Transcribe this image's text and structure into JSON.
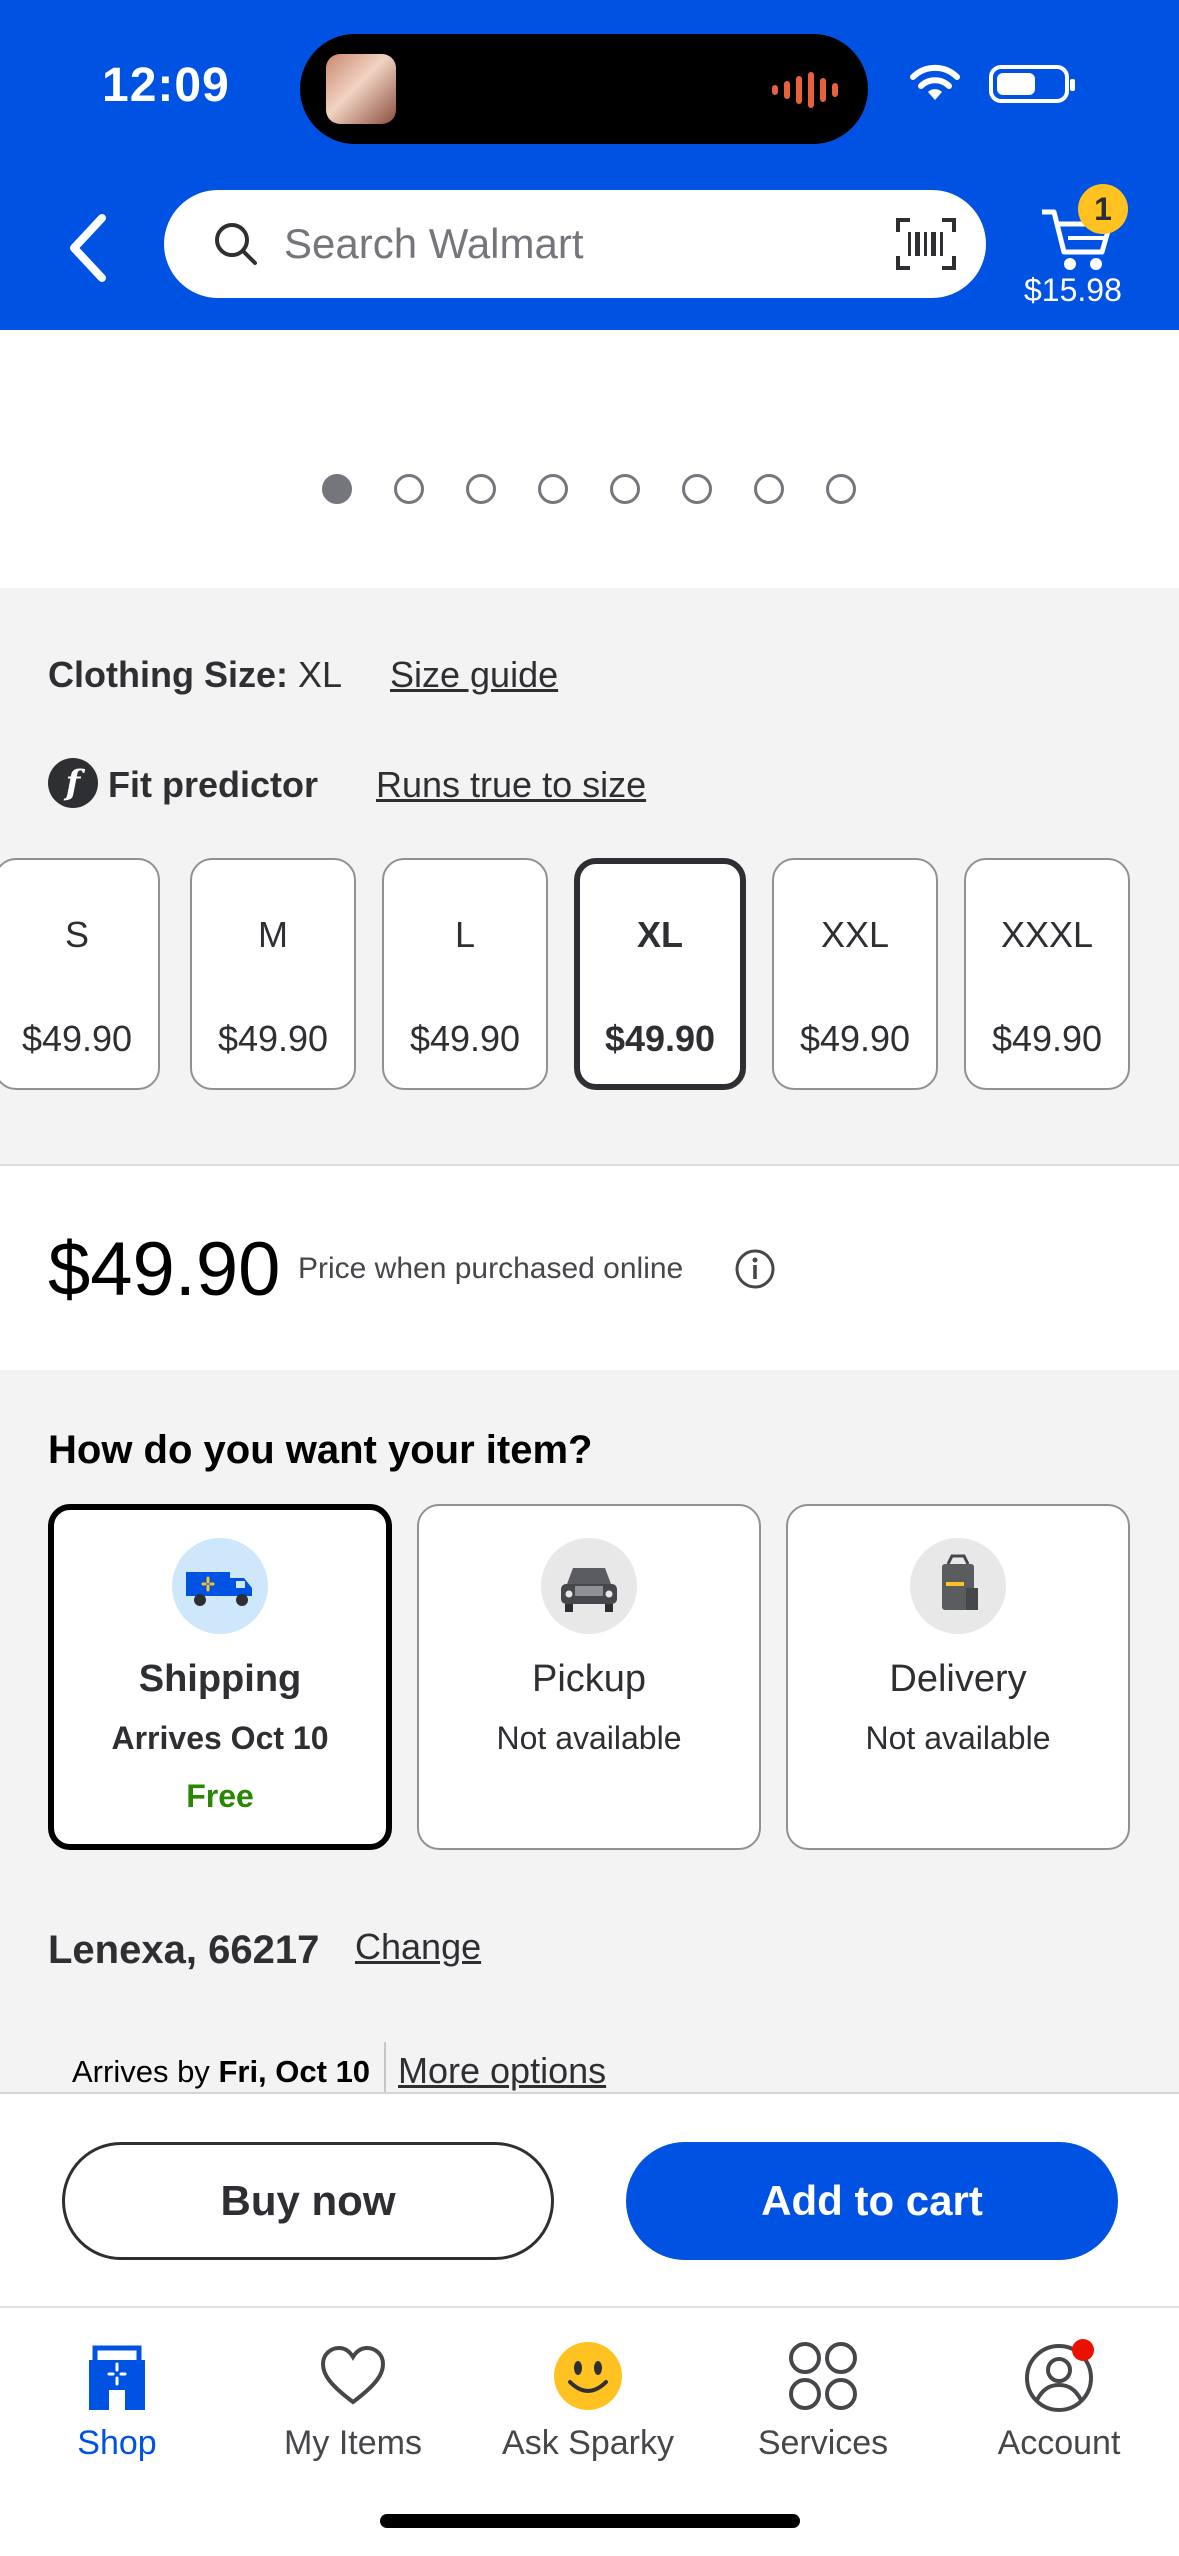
{
  "status_bar": {
    "time": "12:09"
  },
  "header": {
    "search": {
      "placeholder": "Search Walmart"
    },
    "cart": {
      "count": "1",
      "total": "$15.98"
    }
  },
  "carousel": {
    "dot_count": 8,
    "active_index": 0
  },
  "size_selector": {
    "label": "Clothing Size:",
    "selected_value": "XL",
    "size_guide": "Size guide",
    "fit_icon_letter": "f",
    "fit_predictor": "Fit predictor",
    "fit_result": "Runs true to size",
    "options": [
      {
        "size": "S",
        "price": "$49.90"
      },
      {
        "size": "M",
        "price": "$49.90"
      },
      {
        "size": "L",
        "price": "$49.90"
      },
      {
        "size": "XL",
        "price": "$49.90"
      },
      {
        "size": "XXL",
        "price": "$49.90"
      },
      {
        "size": "XXXL",
        "price": "$49.90"
      }
    ]
  },
  "price": {
    "amount": "$49.90",
    "note": "Price when purchased online"
  },
  "fulfillment": {
    "title": "How do you want your item?",
    "options": [
      {
        "title": "Shipping",
        "subtitle": "Arrives Oct 10",
        "fee": "Free",
        "icon": "truck-icon"
      },
      {
        "title": "Pickup",
        "subtitle": "Not available",
        "icon": "car-icon"
      },
      {
        "title": "Delivery",
        "subtitle": "Not available",
        "icon": "bag-icon"
      }
    ],
    "location": "Lenexa, 66217",
    "change": "Change",
    "arrives_prefix": "Arrives by",
    "arrives_date": "Fri, Oct 10",
    "more_options": "More options"
  },
  "actions": {
    "buy_now": "Buy now",
    "add_to_cart": "Add to cart"
  },
  "tabs": [
    {
      "label": "Shop",
      "icon": "store-icon"
    },
    {
      "label": "My Items",
      "icon": "heart-icon"
    },
    {
      "label": "Ask Sparky",
      "icon": "sparky-icon"
    },
    {
      "label": "Services",
      "icon": "services-icon"
    },
    {
      "label": "Account",
      "icon": "account-icon"
    }
  ],
  "colors": {
    "brand_blue": "#0053e2",
    "badge_yellow": "#ffc220",
    "free_green": "#2a8703",
    "notification_red": "#ea1100"
  }
}
